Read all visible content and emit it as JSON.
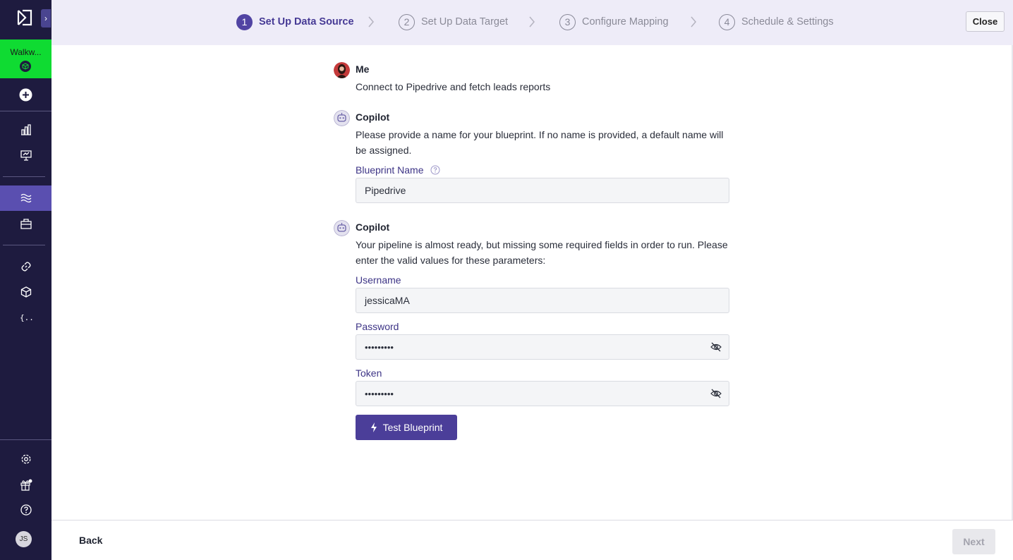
{
  "sidebar": {
    "workspace_name": "Walkw...",
    "user_initials": "JS",
    "expand_glyph": "›",
    "icons": [
      "logo-icon",
      "add-icon",
      "analytics-icon",
      "dashboard-icon",
      "pipelines-icon",
      "toolkit-icon",
      "connections-icon",
      "components-icon",
      "variables-icon",
      "settings-icon",
      "gift-icon",
      "help-icon"
    ]
  },
  "steps": [
    {
      "num": "1",
      "label": "Set Up Data Source",
      "active": true
    },
    {
      "num": "2",
      "label": "Set Up Data Target",
      "active": false
    },
    {
      "num": "3",
      "label": "Configure Mapping",
      "active": false
    },
    {
      "num": "4",
      "label": "Schedule & Settings",
      "active": false
    }
  ],
  "topbar": {
    "close_label": "Close"
  },
  "chat": {
    "user_message": {
      "sender": "Me",
      "text": "Connect to Pipedrive and fetch leads reports"
    },
    "copilot_message_1": {
      "sender": "Copilot",
      "text": "Please provide a name for your blueprint. If no name is provided, a default name will be assigned."
    },
    "copilot_message_2": {
      "sender": "Copilot",
      "text": "Your pipeline is almost ready, but missing some required fields in order to run. Please enter the valid values for these parameters:"
    }
  },
  "form": {
    "blueprint_name_label": "Blueprint Name",
    "blueprint_name_value": "Pipedrive",
    "username_label": "Username",
    "username_value": "jessicaMA",
    "password_label": "Password",
    "password_value": "•••••••••",
    "token_label": "Token",
    "token_value": "•••••••••",
    "test_button_label": "Test Blueprint"
  },
  "footer": {
    "back_label": "Back",
    "next_label": "Next"
  },
  "colors": {
    "sidebar": "#1e1b3f",
    "accent": "#4b3e99",
    "workspace": "#0fdb32",
    "topbar": "#eeecf8"
  }
}
